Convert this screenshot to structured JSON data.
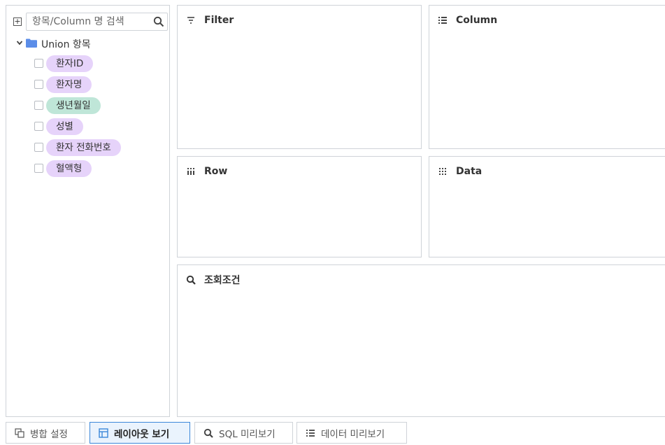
{
  "search": {
    "placeholder": "항목/Column 명 검색"
  },
  "tree": {
    "root_label": "Union 항목",
    "items": [
      {
        "label": "환자ID",
        "color": "#e6d3fa"
      },
      {
        "label": "환자명",
        "color": "#e6d3fa"
      },
      {
        "label": "생년월일",
        "color": "#bfe6d8"
      },
      {
        "label": "성별",
        "color": "#e6d3fa"
      },
      {
        "label": "환자 전화번호",
        "color": "#e6d3fa"
      },
      {
        "label": "혈액형",
        "color": "#e6d3fa"
      }
    ]
  },
  "zones": {
    "filter": {
      "title": "Filter",
      "icon": "filter-icon"
    },
    "column": {
      "title": "Column",
      "icon": "column-icon"
    },
    "row": {
      "title": "Row",
      "icon": "row-icon"
    },
    "data": {
      "title": "Data",
      "icon": "data-icon"
    },
    "condition": {
      "title": "조회조건",
      "icon": "search-icon"
    }
  },
  "tabs": [
    {
      "label": "병합 설정",
      "icon": "merge-icon",
      "active": false
    },
    {
      "label": "레이아웃 보기",
      "icon": "layout-icon",
      "active": true
    },
    {
      "label": "SQL 미리보기",
      "icon": "search-icon",
      "active": false
    },
    {
      "label": "데이터 미리보기",
      "icon": "list-icon",
      "active": false
    }
  ],
  "colors": {
    "accent": "#3b87d9",
    "folder": "#5b8de8",
    "border": "#cfd3d8"
  }
}
